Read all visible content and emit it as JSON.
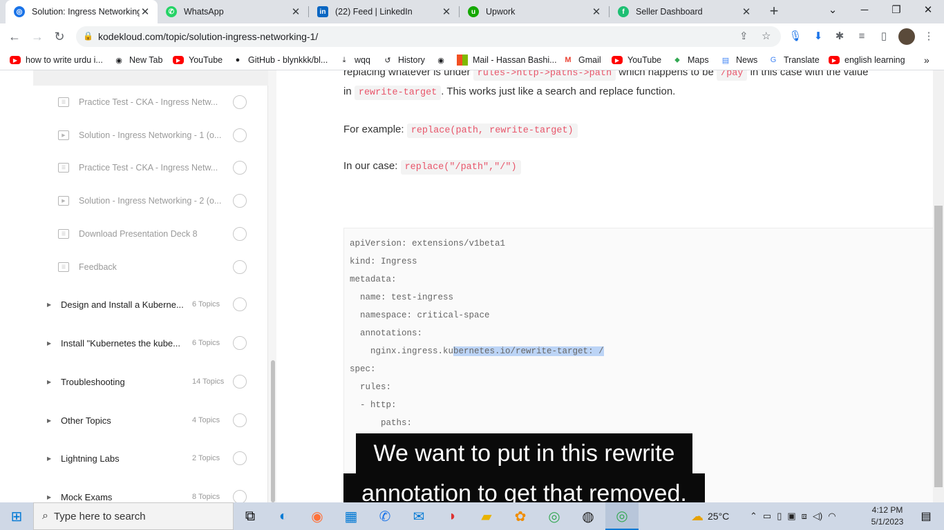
{
  "browser": {
    "tabs": [
      {
        "title": "Solution: Ingress Networking",
        "icon": "kodekloud-icon",
        "color": "#1a73e8"
      },
      {
        "title": "WhatsApp",
        "icon": "whatsapp-icon",
        "color": "#25d366"
      },
      {
        "title": "(22) Feed | LinkedIn",
        "icon": "linkedin-icon",
        "color": "#0a66c2"
      },
      {
        "title": "Upwork",
        "icon": "upwork-icon",
        "color": "#14a800"
      },
      {
        "title": "Seller Dashboard",
        "icon": "fiverr-icon",
        "color": "#1dbf73"
      }
    ],
    "url": "kodekloud.com/topic/solution-ingress-networking-1/",
    "bookmarks": [
      {
        "label": "how to write urdu i...",
        "icon": "youtube-icon"
      },
      {
        "label": "New Tab",
        "icon": "globe-icon"
      },
      {
        "label": "YouTube",
        "icon": "youtube-icon"
      },
      {
        "label": "GitHub - blynkkk/bl...",
        "icon": "github-icon"
      },
      {
        "label": "wqq",
        "icon": "download-icon"
      },
      {
        "label": "History",
        "icon": "history-icon"
      },
      {
        "label": "Mail - Hassan Bashi...",
        "icon": "microsoft-icon"
      },
      {
        "label": "Gmail",
        "icon": "gmail-icon"
      },
      {
        "label": "YouTube",
        "icon": "youtube-icon"
      },
      {
        "label": "Maps",
        "icon": "maps-icon"
      },
      {
        "label": "News",
        "icon": "news-icon"
      },
      {
        "label": "Translate",
        "icon": "translate-icon"
      },
      {
        "label": "english learning",
        "icon": "youtube-icon"
      }
    ]
  },
  "sidebar": {
    "lessons": [
      {
        "label": "Practice Test - CKA - Ingress Netw...",
        "icon": "quiz-icon"
      },
      {
        "label": "Solution - Ingress Networking - 1 (o...",
        "icon": "video-icon"
      },
      {
        "label": "Practice Test - CKA - Ingress Netw...",
        "icon": "quiz-icon"
      },
      {
        "label": "Solution - Ingress Networking - 2 (o...",
        "icon": "video-icon"
      },
      {
        "label": "Download Presentation Deck 8",
        "icon": "quiz-icon"
      },
      {
        "label": "Feedback",
        "icon": "quiz-icon"
      }
    ],
    "sections": [
      {
        "label": "Design and Install a Kuberne...",
        "count": "6 Topics"
      },
      {
        "label": "Install \"Kubernetes the kube...",
        "count": "6 Topics"
      },
      {
        "label": "Troubleshooting",
        "count": "14 Topics"
      },
      {
        "label": "Other Topics",
        "count": "4 Topics"
      },
      {
        "label": "Lightning Labs",
        "count": "2 Topics"
      },
      {
        "label": "Mock Exams",
        "count": "8 Topics"
      }
    ]
  },
  "article": {
    "line1_pre": "replacing whatever is under",
    "line1_code1": "rules->http->paths->path",
    "line1_mid": "which happens to be",
    "line1_code2": "/pay",
    "line1_post": "in this case with the value",
    "line2_pre": "in",
    "line2_code": "rewrite-target",
    "line2_post": ". This works just like a search and replace function.",
    "example_label": "For example:",
    "example_code": "replace(path, rewrite-target)",
    "case_label": "In our case:",
    "case_code": "replace(\"/path\",\"/\")"
  },
  "code": {
    "lines": [
      "apiVersion: extensions/v1beta1",
      "kind: Ingress",
      "metadata:",
      "  name: test-ingress",
      "  namespace: critical-space",
      "  annotations:",
      "spec:",
      "  rules:",
      "  - http:",
      "      paths:"
    ],
    "anno_pre": "    nginx.ingress.ku",
    "anno_sel": "bernetes.io/rewrite-target: /"
  },
  "captions": {
    "line1": "We want to put in this rewrite",
    "line2": "annotation to get that removed."
  },
  "taskbar": {
    "search_placeholder": "Type here to search",
    "temperature": "25°C",
    "time": "4:12 PM",
    "date": "5/1/2023"
  }
}
